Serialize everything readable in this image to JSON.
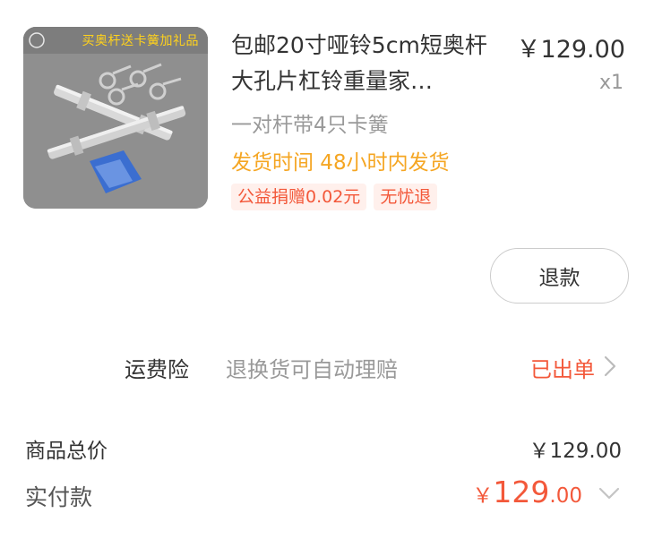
{
  "product": {
    "thumbnail_banner": "买奥杆送卡簧加礼品",
    "title": "包邮20寸哑铃5cm短奥杆大孔片杠铃重量家…",
    "price": "￥129.00",
    "quantity": "x1",
    "spec": "一对杆带4只卡簧",
    "shipping": "发货时间 48小时内发货",
    "tags": [
      "公益捐赠0.02元",
      "无忧退"
    ]
  },
  "actions": {
    "refund_label": "退款"
  },
  "insurance": {
    "label": "运费险",
    "description": "退换货可自动理赔",
    "status": "已出单"
  },
  "totals": {
    "goods_total_label": "商品总价",
    "goods_total_value": "￥129.00",
    "paid_label": "实付款",
    "paid_currency": "￥",
    "paid_integer": "129",
    "paid_decimal": ".00"
  },
  "colors": {
    "accent": "#f3583a",
    "shipping": "#f5a623",
    "muted": "#999999"
  },
  "icons": [
    "chevron-right-icon",
    "chevron-down-icon"
  ]
}
